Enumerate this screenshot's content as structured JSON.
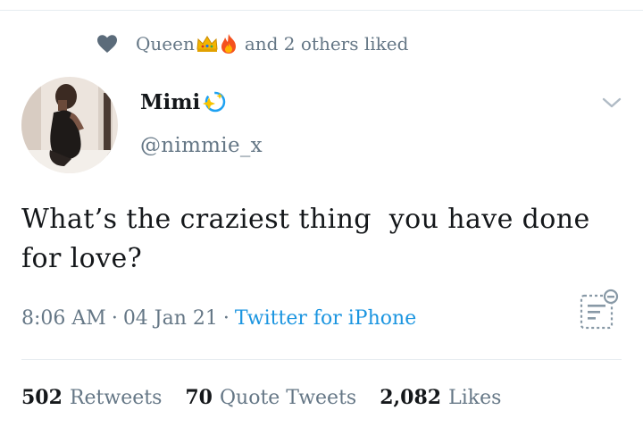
{
  "social_context": {
    "liker_name": "Queen",
    "emojis": [
      "crown-emoji",
      "fire-emoji"
    ],
    "rest": "and 2 others liked"
  },
  "author": {
    "name": "Mimi",
    "handle": "@nimmie_x"
  },
  "tweet": {
    "text": "What’s the craziest thing  you have done\nfor love?"
  },
  "meta": {
    "time": "8:06 AM",
    "separator": "·",
    "date": "04 Jan 21",
    "source": "Twitter for iPhone"
  },
  "stats": {
    "retweets_count": "502",
    "retweets_label": "Retweets",
    "quotes_count": "70",
    "quotes_label": "Quote Tweets",
    "likes_count": "2,082",
    "likes_label": "Likes"
  },
  "colors": {
    "text": "#14171a",
    "secondary": "#657786",
    "link": "#1b95e0",
    "divider": "#e6ecf0"
  },
  "icons": [
    "heart-icon",
    "crown-emoji",
    "fire-emoji",
    "sparkle-icon",
    "chevron-down-icon",
    "analytics-icon"
  ]
}
